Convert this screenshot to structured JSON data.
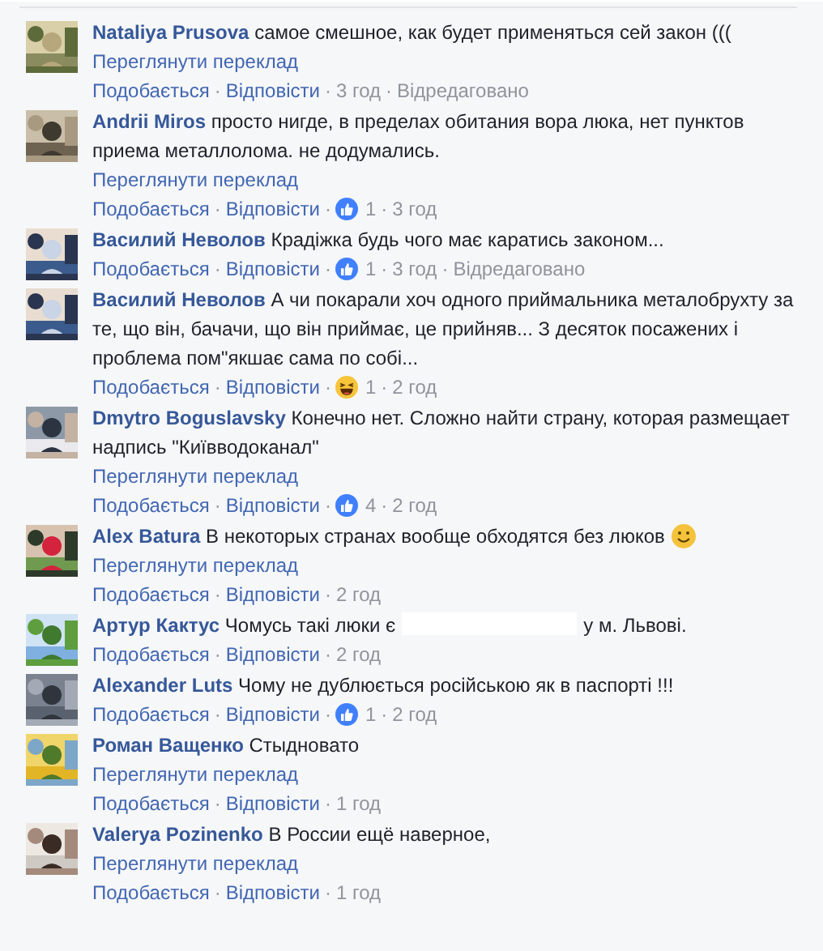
{
  "separator": "·",
  "comments": [
    {
      "author": "Nataliya Prusova",
      "text": "самое смешное, как будет применяться сей закон (((",
      "translate": "Переглянути переклад",
      "like": "Подобається",
      "reply": "Відповісти",
      "time": "3 год",
      "edited": "Відредаговано"
    },
    {
      "author": "Andrii Miros",
      "text": "просто нигде, в пределах обитания вора люка, нет пунктов приема металлолома. не додумались.",
      "translate": "Переглянути переклад",
      "like": "Подобається",
      "reply": "Відповісти",
      "reaction": {
        "kind": "like",
        "count": "1"
      },
      "time": "3 год"
    },
    {
      "author": "Василий Неволов",
      "text": "Крадіжка будь чого має каратись законом...",
      "like": "Подобається",
      "reply": "Відповісти",
      "reaction": {
        "kind": "like",
        "count": "1"
      },
      "time": "3 год",
      "edited": "Відредаговано"
    },
    {
      "author": "Василий Неволов",
      "text": "А чи покарали хоч одного приймальника металобрухту за те, що він, бачачи, що він приймає, це прийняв... З десяток посажених і проблема пом\"якшає сама по собі...",
      "like": "Подобається",
      "reply": "Відповісти",
      "reaction": {
        "kind": "haha",
        "count": "1"
      },
      "time": "2 год"
    },
    {
      "author": "Dmytro Boguslavsky",
      "text": "Конечно нет. Сложно найти страну, которая размещает надпись \"Київводоканал\"",
      "translate": "Переглянути переклад",
      "like": "Подобається",
      "reply": "Відповісти",
      "reaction": {
        "kind": "like",
        "count": "4"
      },
      "time": "2 год"
    },
    {
      "author": "Alex Batura",
      "text": "В некоторых странах вообще обходятся без люков",
      "emoji": {
        "kind": "smile"
      },
      "translate": "Переглянути переклад",
      "like": "Подобається",
      "reply": "Відповісти",
      "time": "2 год"
    },
    {
      "author": "Артур Кактус",
      "text": "Чомусь такі люки є",
      "redacted": true,
      "text_after": "у м. Львові.",
      "like": "Подобається",
      "reply": "Відповісти",
      "time": "2 год"
    },
    {
      "author": "Alexander Luts",
      "text": "Чому не дублюється російською як в паспорті !!!",
      "like": "Подобається",
      "reply": "Відповісти",
      "reaction": {
        "kind": "like",
        "count": "1"
      },
      "time": "2 год"
    },
    {
      "author": "Роман Ващенко",
      "text": "Стыдновато",
      "translate": "Переглянути переклад",
      "like": "Подобається",
      "reply": "Відповісти",
      "time": "1 год"
    },
    {
      "author": "Valerya Pozinenko",
      "text": "В России ещё наверное,",
      "translate": "Переглянути переклад",
      "like": "Подобається",
      "reply": "Відповісти",
      "time": "1 год"
    }
  ]
}
